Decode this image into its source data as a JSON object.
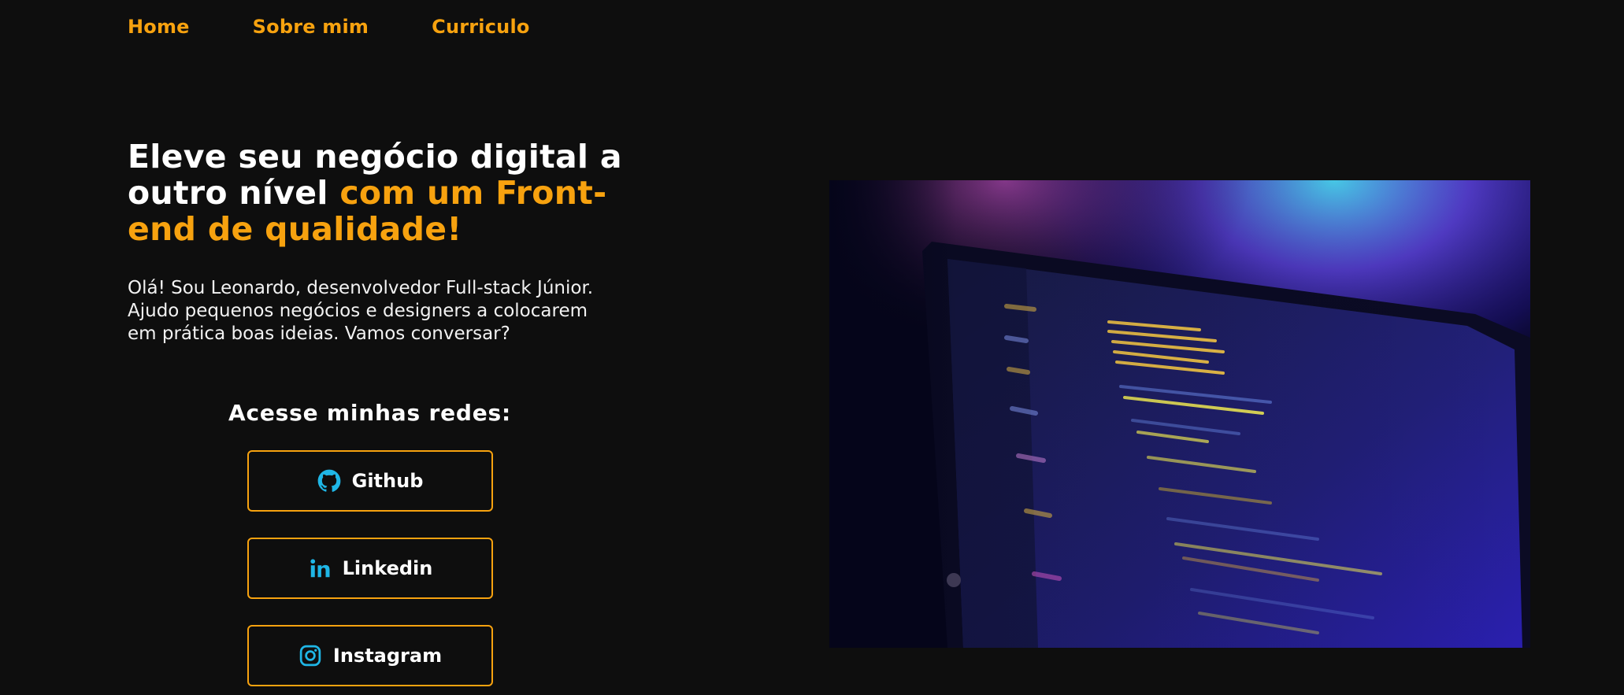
{
  "nav": {
    "items": [
      {
        "label": "Home"
      },
      {
        "label": "Sobre mim"
      },
      {
        "label": "Curriculo"
      }
    ]
  },
  "hero": {
    "title_part1": "Eleve seu negócio digital a outro nível ",
    "title_part2": "com um Front-end de qualidade!",
    "intro": "Olá! Sou Leonardo, desenvolvedor Full-stack Júnior. Ajudo pequenos negócios e designers a colocarem em prática boas ideias. Vamos conversar?"
  },
  "socials": {
    "heading": "Acesse minhas redes:",
    "buttons": [
      {
        "label": "Github",
        "icon": "github-icon"
      },
      {
        "label": "Linkedin",
        "icon": "linkedin-icon"
      },
      {
        "label": "Instagram",
        "icon": "instagram-icon"
      }
    ]
  },
  "colors": {
    "accent": "#f7a20f",
    "background": "#0e0e0e",
    "icon": "#1fb6e6"
  },
  "image": {
    "subject": "laptop-with-code-editor"
  }
}
